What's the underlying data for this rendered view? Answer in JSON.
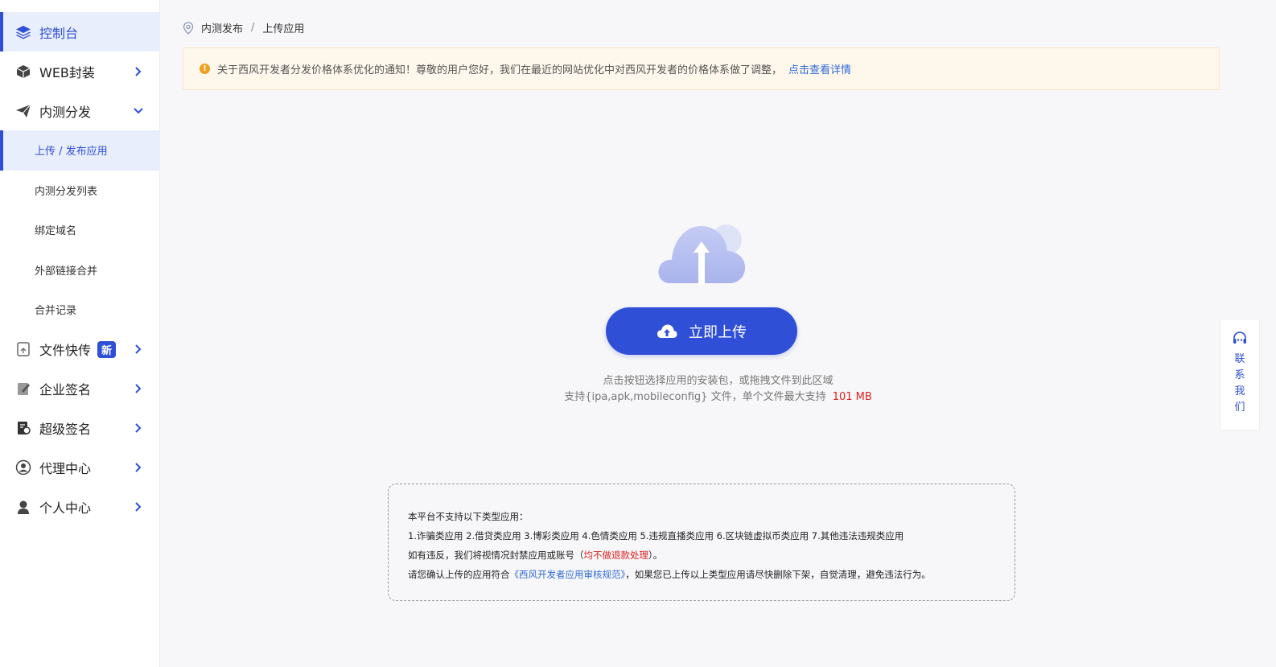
{
  "sidebar": {
    "items": [
      {
        "label": "控制台",
        "icon": "layers-icon"
      },
      {
        "label": "WEB封装",
        "icon": "box-icon"
      },
      {
        "label": "内测分发",
        "icon": "paper-plane-icon"
      },
      {
        "label": "文件快传",
        "icon": "file-transfer-icon",
        "badge": "新"
      },
      {
        "label": "企业签名",
        "icon": "document-sign-icon"
      },
      {
        "label": "超级签名",
        "icon": "certificate-icon"
      },
      {
        "label": "代理中心",
        "icon": "agent-icon"
      },
      {
        "label": "个人中心",
        "icon": "user-icon"
      }
    ],
    "sub_items": [
      {
        "label": "上传 / 发布应用"
      },
      {
        "label": "内测分发列表"
      },
      {
        "label": "绑定域名"
      },
      {
        "label": "外部链接合并"
      },
      {
        "label": "合并记录"
      }
    ]
  },
  "breadcrumb": {
    "parent": "内测发布",
    "separator": "/",
    "current": "上传应用"
  },
  "notice": {
    "text": "关于西风开发者分发价格体系优化的通知！尊敬的用户您好，我们在最近的网站优化中对西风开发者的价格体系做了调整，",
    "link": "点击查看详情"
  },
  "upload": {
    "button_label": "立即上传",
    "hint_line1": "点击按钮选择应用的安装包，或拖拽文件到此区域",
    "hint_line2_prefix": "支持{ipa,apk,mobileconfig} 文件，单个文件最大支持",
    "max_size": "101 MB"
  },
  "policy": {
    "line1": "本平台不支持以下类型应用：",
    "line2": "1.诈骗类应用 2.借贷类应用 3.博彩类应用 4.色情类应用 5.违规直播类应用 6.区块链虚拟币类应用 7.其他违法违规类应用",
    "line3_prefix": "如有违反，我们将视情况封禁应用或账号（",
    "line3_red": "均不做退款处理",
    "line3_suffix": "）。",
    "line4_prefix": "请您确认上传的应用符合",
    "line4_link": "《西风开发者应用审核规范》",
    "line4_suffix": "，如果您已上传以上类型应用请尽快删除下架，自觉清理，避免违法行为。"
  },
  "contact": {
    "chars": [
      "联",
      "系",
      "我",
      "们"
    ],
    "icon": "headset-icon"
  },
  "colors": {
    "accent": "#2f4fd6",
    "warning": "#f0a020",
    "danger": "#e02020",
    "link": "#2f6bd6"
  }
}
